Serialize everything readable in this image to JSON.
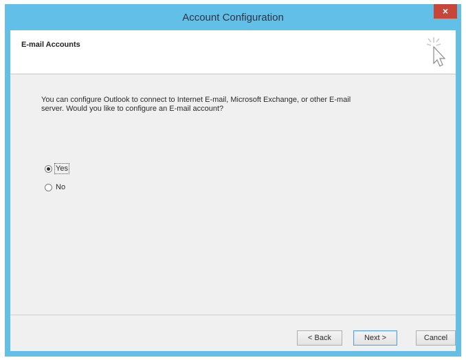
{
  "window": {
    "title": "Account Configuration",
    "close_glyph": "×"
  },
  "header": {
    "title": "E-mail Accounts",
    "icon": "wizard-cursor-icon"
  },
  "main": {
    "prompt": "You can configure Outlook to connect to Internet E-mail, Microsoft Exchange, or other E-mail server. Would you like to configure an E-mail account?",
    "options": [
      {
        "label": "Yes",
        "selected": true
      },
      {
        "label": "No",
        "selected": false
      }
    ]
  },
  "footer": {
    "back_label": "< Back",
    "next_label": "Next >",
    "cancel_label": "Cancel"
  },
  "colors": {
    "titlebar": "#62c0e8",
    "close": "#c7463a",
    "client": "#f0f0f0"
  }
}
